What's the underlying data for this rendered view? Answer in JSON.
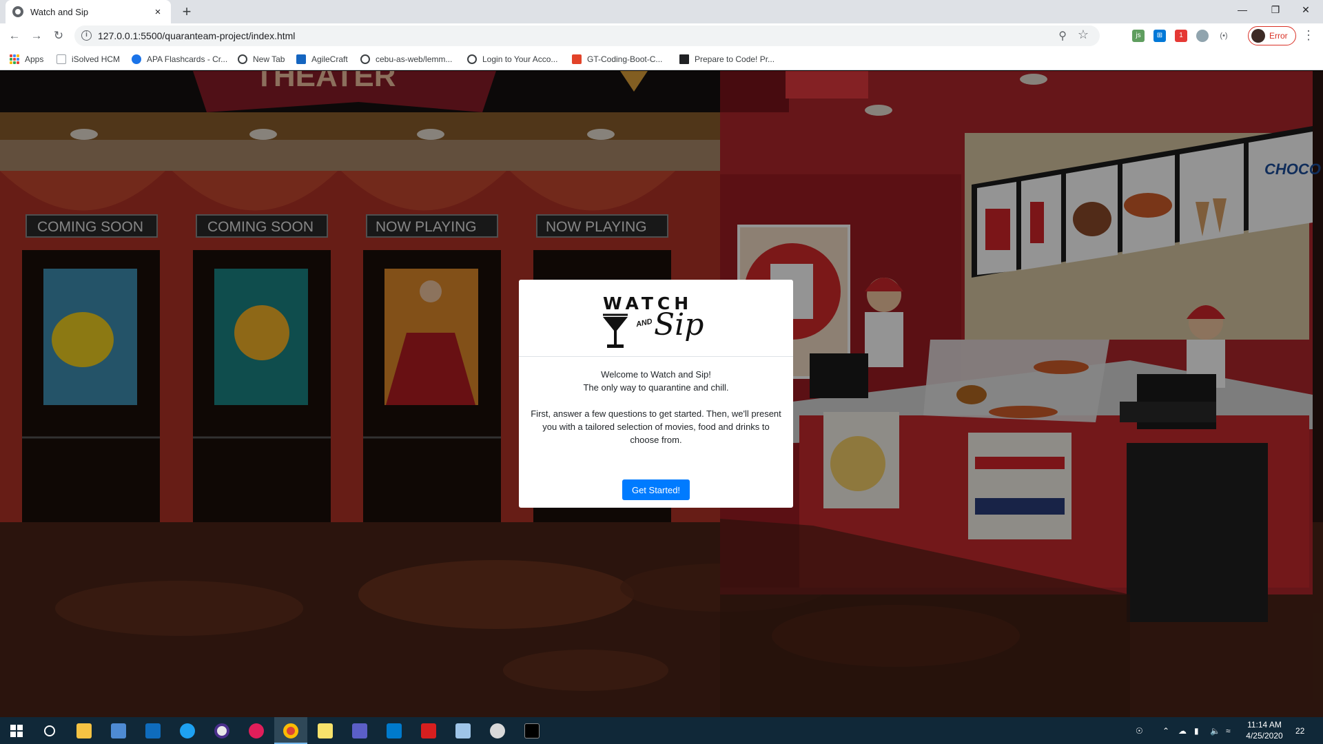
{
  "tab": {
    "title": "Watch and Sip",
    "close": "×",
    "new": "+"
  },
  "window_controls": {
    "minimize": "—",
    "restore": "❐",
    "close": "✕"
  },
  "nav": {
    "back": "←",
    "forward": "→",
    "reload": "↻"
  },
  "address": {
    "url": "127.0.0.1:5500/quaranteam-project/index.html",
    "info": "i"
  },
  "profile": {
    "status": "Error"
  },
  "bookmarks": [
    {
      "label": "Apps",
      "icon": "apps-grid-icon",
      "color": "#4285f4"
    },
    {
      "label": "iSolved HCM",
      "icon": "page-icon",
      "color": "#9aa0a6"
    },
    {
      "label": "APA Flashcards - Cr...",
      "icon": "c-logo-icon",
      "color": "#1a73e8"
    },
    {
      "label": "New Tab",
      "icon": "globe-icon",
      "color": "#3c4043"
    },
    {
      "label": "AgileCraft",
      "icon": "agilecraft-icon",
      "color": "#1565c0"
    },
    {
      "label": "cebu-as-web/lemm...",
      "icon": "globe-icon",
      "color": "#3c4043"
    },
    {
      "label": "Login to Your Acco...",
      "icon": "globe-icon",
      "color": "#3c4043"
    },
    {
      "label": "GT-Coding-Boot-C...",
      "icon": "gitlab-icon",
      "color": "#e24329"
    },
    {
      "label": "Prepare to Code! Pr...",
      "icon": "book-icon",
      "color": "#202124"
    }
  ],
  "scene": {
    "marquees": [
      "COMING SOON",
      "COMING SOON",
      "NOW PLAYING",
      "NOW PLAYING"
    ],
    "theater_sign": "THEATER",
    "snack_sign": "CHOCO BAR"
  },
  "modal": {
    "logo_word": "WATCH",
    "logo_and": "AND",
    "logo_sip": "Sip",
    "welcome_line1": "Welcome to Watch and Sip!",
    "welcome_line2": "The only way to quarantine and chill.",
    "instructions": "First, answer a few questions to get started. Then, we'll present you with a tailored selection of movies, food and drinks to choose from.",
    "button": "Get Started!"
  },
  "taskbar": {
    "time": "11:14 AM",
    "date": "4/25/2020",
    "notifications": "22"
  },
  "colors": {
    "accent": "#007bff",
    "taskbar": "#102838",
    "error": "#d93025"
  }
}
